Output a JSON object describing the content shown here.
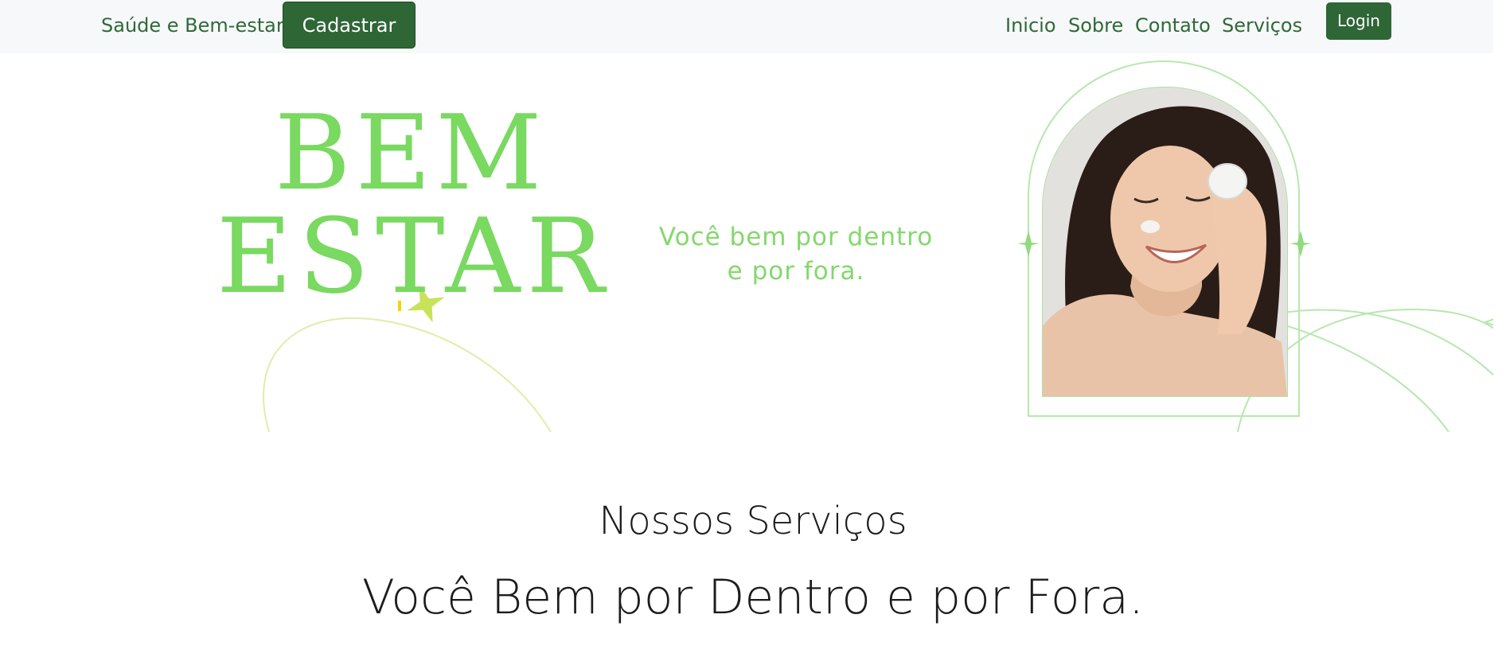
{
  "navbar": {
    "brand": "Saúde e Bem-estar",
    "register_label": "Cadastrar",
    "links": [
      "Inicio",
      "Sobre",
      "Contato",
      "Serviços"
    ],
    "login_label": "Login"
  },
  "hero": {
    "title_line1": "BEM",
    "title_line2": "ESTAR",
    "tagline": "Você bem por dentro\ne por fora.",
    "image": "smiling woman applying face cream"
  },
  "services": {
    "title": "Nossos Serviços",
    "subtitle": "Você Bem por Dentro e por Fora."
  },
  "colors": {
    "nav_bg": "#f7f8f9",
    "nav_text": "#2f6a38",
    "button_green": "#2e6636",
    "hero_green": "#79d960",
    "tagline_green": "#84d86c",
    "arch_line": "#a8e4a0"
  }
}
